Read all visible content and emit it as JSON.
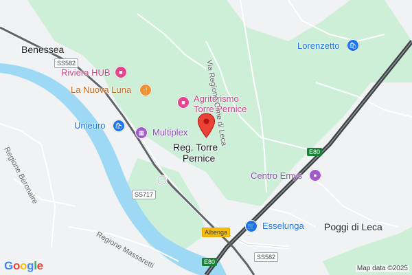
{
  "map": {
    "places": {
      "benessea": "Benessea",
      "lorenzetto": "Lorenzetto",
      "poggi_di_leca": "Poggi di Leca",
      "reg_torre_pernice_1": "Reg. Torre",
      "reg_torre_pernice_2": "Pernice"
    },
    "pois": {
      "riviera_hub": "Riviera HUB",
      "la_nuova_luna": "La Nuova Luna",
      "agriturismo_1": "Agriturismo",
      "agriturismo_2": "Torre Pernice",
      "unieuro": "Unieuro",
      "multiplex": "Multiplex",
      "centro_emys": "Centro Emys",
      "esselunga": "Esselunga"
    },
    "streets": {
      "via_regione_cime_di_leca": "Via Regione Cime di Leca",
      "regione_beronaire": "Regione Beronaire",
      "regione_massaretti": "Regione Massaretti"
    },
    "shields": {
      "ss582_top": "SS582",
      "ss717": "SS717",
      "albenga": "Albenga",
      "e80_right": "E80",
      "e80_bottom": "E80",
      "ss582_bottom": "SS582"
    },
    "attribution": "Map data ©2025",
    "logo": "Google",
    "colors": {
      "land": "#f1f2f4",
      "park": "#c9f0d6",
      "water": "#9dd9f5",
      "highway": "#3c4043",
      "pin": "#ea4335"
    }
  }
}
